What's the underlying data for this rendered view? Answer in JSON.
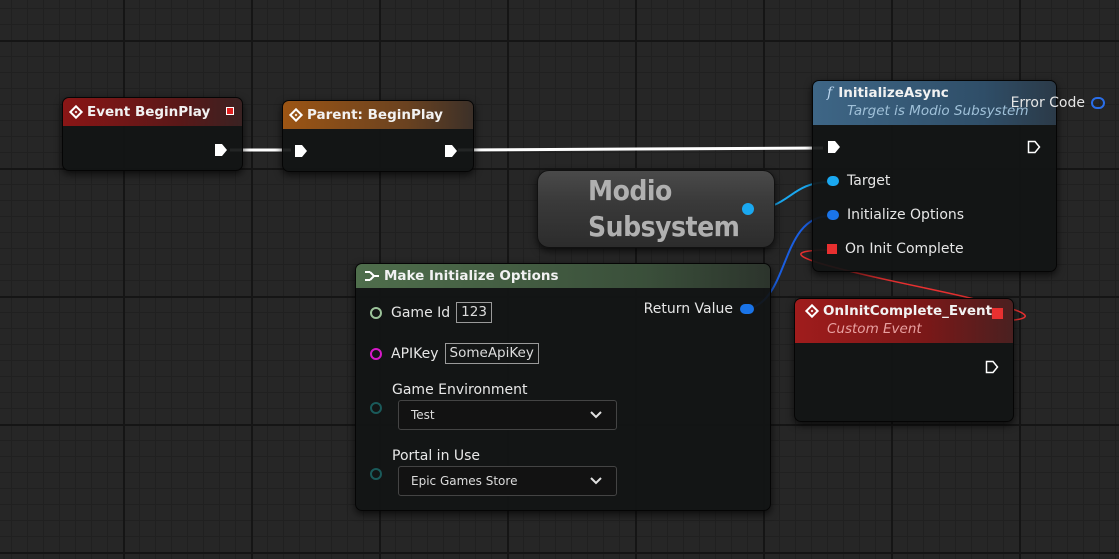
{
  "nodes": {
    "event_beginplay": {
      "title": "Event BeginPlay"
    },
    "parent_beginplay": {
      "title": "Parent: BeginPlay"
    },
    "initialize_async": {
      "title": "InitializeAsync",
      "subtitle": "Target is Modio Subsystem",
      "func_glyph": "f",
      "pins": {
        "target": "Target",
        "initialize_options": "Initialize Options",
        "on_init_complete": "On Init Complete"
      }
    },
    "modio_subsystem": {
      "line1": "Modio",
      "line2": "Subsystem"
    },
    "make_initialize_options": {
      "title": "Make Initialize Options",
      "pins": {
        "game_id": "Game Id",
        "game_id_value": "123",
        "api_key": "APIKey",
        "api_key_value": "SomeApiKey",
        "game_environment": "Game Environment",
        "game_environment_value": "Test",
        "portal_in_use": "Portal in Use",
        "portal_in_use_value": "Epic Games Store",
        "return_value": "Return Value"
      }
    },
    "on_init_complete_event": {
      "title": "OnInitComplete_Event",
      "subtitle": "Custom Event",
      "pins": {
        "error_code": "Error Code"
      }
    }
  },
  "colors": {
    "exec_wire": "#ffffff",
    "object_wire": "#1aa8f0",
    "struct_wire": "#1a5ee0",
    "delegate_wire": "#e83030"
  }
}
